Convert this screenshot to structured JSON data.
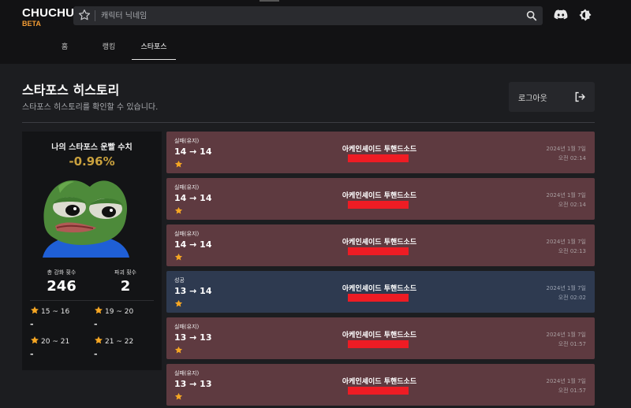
{
  "header": {
    "logo": "CHUCHU",
    "logo_badge": "BETA",
    "search_placeholder": "캐릭터 닉네임",
    "tabs": [
      {
        "label": "홈"
      },
      {
        "label": "랭킹"
      },
      {
        "label": "스타포스",
        "active": true
      }
    ]
  },
  "page": {
    "title": "스타포스 히스토리",
    "subtitle": "스타포스 히스토리를 확인할 수 있습니다.",
    "logout_label": "로그아웃"
  },
  "stats": {
    "title": "나의 스타포스 운빨 수치",
    "percent": "-0.96%",
    "total_label": "총 강화 횟수",
    "total_value": "246",
    "destroy_label": "파괴 횟수",
    "destroy_value": "2",
    "ranges": [
      {
        "label": "15 ~ 16",
        "value": "-"
      },
      {
        "label": "19 ~ 20",
        "value": "-"
      },
      {
        "label": "20 ~ 21",
        "value": "-"
      },
      {
        "label": "21 ~ 22",
        "value": "-"
      }
    ]
  },
  "history": [
    {
      "status": "실패(유지)",
      "levels": "14 → 14",
      "item": "아케인셰이드 투핸드소드",
      "date": "2024년 1월 7일",
      "time": "오전 02:14",
      "result": "fail"
    },
    {
      "status": "실패(유지)",
      "levels": "14 → 14",
      "item": "아케인셰이드 투핸드소드",
      "date": "2024년 1월 7일",
      "time": "오전 02:14",
      "result": "fail"
    },
    {
      "status": "실패(유지)",
      "levels": "14 → 14",
      "item": "아케인셰이드 투핸드소드",
      "date": "2024년 1월 7일",
      "time": "오전 02:13",
      "result": "fail"
    },
    {
      "status": "성공",
      "levels": "13 → 14",
      "item": "아케인셰이드 투핸드소드",
      "date": "2024년 1월 7일",
      "time": "오전 02:02",
      "result": "success"
    },
    {
      "status": "실패(유지)",
      "levels": "13 → 13",
      "item": "아케인셰이드 투핸드소드",
      "date": "2024년 1월 7일",
      "time": "오전 01:57",
      "result": "fail"
    },
    {
      "status": "실패(유지)",
      "levels": "13 → 13",
      "item": "아케인셰이드 투핸드소드",
      "date": "2024년 1월 7일",
      "time": "오전 01:57",
      "result": "fail"
    }
  ],
  "icons": {
    "favorite": "star-outline-icon",
    "search": "search-icon",
    "discord": "discord-icon",
    "theme": "theme-toggle-icon",
    "logout": "logout-icon",
    "star": "star-icon"
  },
  "colors": {
    "accent": "#f39c34",
    "percent": "#c9a13e",
    "fail_card": "#5e3a40",
    "success_card": "#2e3a50",
    "redaction": "#ee1c24"
  }
}
